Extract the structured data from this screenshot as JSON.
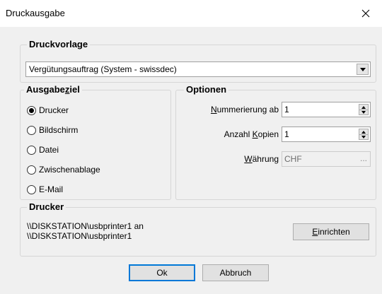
{
  "window": {
    "title": "Druckausgabe"
  },
  "druckvorlage": {
    "legend": "Druckvorlage",
    "selected": "Vergütungsauftrag (System - swissdec)"
  },
  "ausgabeziel": {
    "legend_pre": "Ausgabe",
    "legend_u": "z",
    "legend_post": "iel",
    "options": [
      "Drucker",
      "Bildschirm",
      "Datei",
      "Zwischenablage",
      "E-Mail"
    ],
    "selected_index": 0
  },
  "optionen": {
    "legend": "Optionen",
    "nummerierung": {
      "label_u": "N",
      "label_rest": "ummerierung ab",
      "value": "1"
    },
    "kopien": {
      "label_pre": "Anzahl ",
      "label_u": "K",
      "label_rest": "opien",
      "value": "1"
    },
    "waehrung": {
      "label_u": "W",
      "label_rest": "ährung",
      "value": "CHF",
      "button": "..."
    }
  },
  "drucker": {
    "legend": "Drucker",
    "line1": "\\\\DISKSTATION\\usbprinter1 an",
    "line2": "\\\\DISKSTATION\\usbprinter1",
    "setup_u": "E",
    "setup_rest": "inrichten"
  },
  "buttons": {
    "ok": "Ok",
    "cancel": "Abbruch"
  }
}
